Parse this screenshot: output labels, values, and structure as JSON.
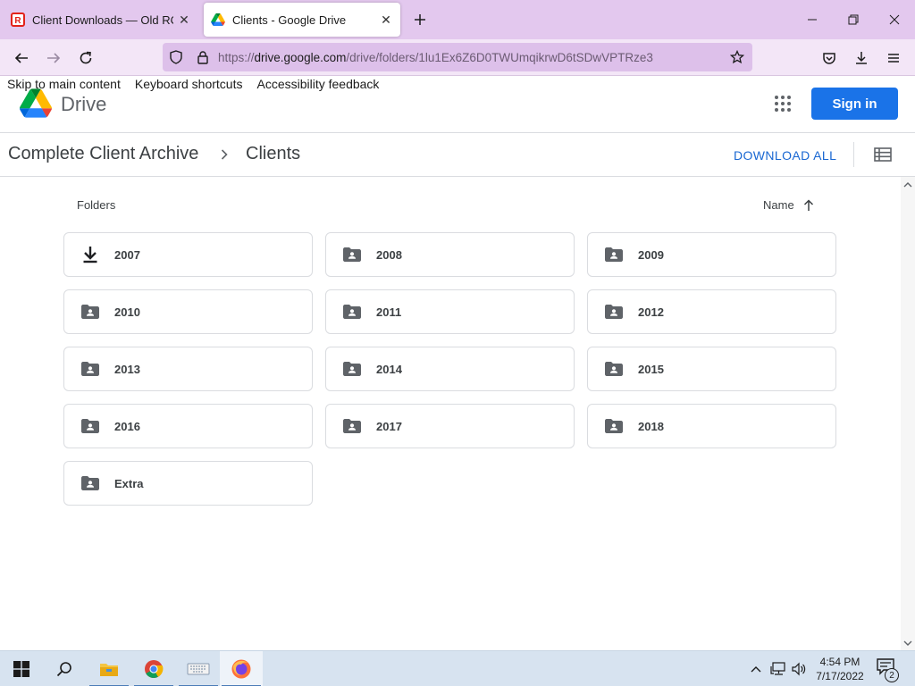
{
  "browser": {
    "tabs": [
      {
        "title": "Client Downloads — Old ROBLOX",
        "favicon": "roblox-icon",
        "active": false
      },
      {
        "title": "Clients - Google Drive",
        "favicon": "google-drive-icon",
        "active": true
      }
    ],
    "url_prefix": "https://",
    "url_host": "drive.google.com",
    "url_path": "/drive/folders/1lu1Ex6Z6D0TWUmqikrwD6tSDwVPTRze3"
  },
  "drive": {
    "skip_links": [
      "Skip to main content",
      "Keyboard shortcuts",
      "Accessibility feedback"
    ],
    "product_name": "Drive",
    "sign_in_label": "Sign in",
    "breadcrumb": [
      "Complete Client Archive",
      "Clients"
    ],
    "download_all_label": "DOWNLOAD ALL",
    "folders_label": "Folders",
    "sort_label": "Name",
    "sort_direction": "ascending",
    "folders": [
      {
        "name": "2007",
        "icon": "download-icon"
      },
      {
        "name": "2008",
        "icon": "shared-folder-icon"
      },
      {
        "name": "2009",
        "icon": "shared-folder-icon"
      },
      {
        "name": "2010",
        "icon": "shared-folder-icon"
      },
      {
        "name": "2011",
        "icon": "shared-folder-icon"
      },
      {
        "name": "2012",
        "icon": "shared-folder-icon"
      },
      {
        "name": "2013",
        "icon": "shared-folder-icon"
      },
      {
        "name": "2014",
        "icon": "shared-folder-icon"
      },
      {
        "name": "2015",
        "icon": "shared-folder-icon"
      },
      {
        "name": "2016",
        "icon": "shared-folder-icon"
      },
      {
        "name": "2017",
        "icon": "shared-folder-icon"
      },
      {
        "name": "2018",
        "icon": "shared-folder-icon"
      },
      {
        "name": "Extra",
        "icon": "shared-folder-icon"
      }
    ]
  },
  "taskbar": {
    "apps": [
      "start-icon",
      "search-icon",
      "file-explorer-icon",
      "chrome-icon",
      "keyboard-icon",
      "firefox-icon"
    ],
    "time": "4:54 PM",
    "date": "7/17/2022",
    "notification_count": "2"
  },
  "colors": {
    "tab_strip": "#e3c8ee",
    "url_bar": "#ddc0ea",
    "accent": "#1a73e8",
    "folder_icon": "#5f6368"
  }
}
